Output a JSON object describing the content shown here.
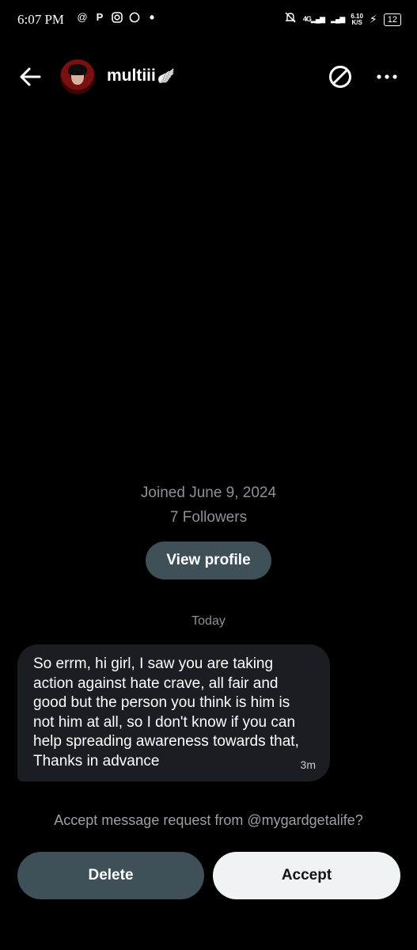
{
  "status_bar": {
    "time": "6:07 PM",
    "network": "4G",
    "speed_value": "6.10",
    "speed_unit": "K/S",
    "battery": "12"
  },
  "header": {
    "name": "multiii",
    "name_emoji": "🪽"
  },
  "profile": {
    "joined": "Joined June 9, 2024",
    "followers": "7 Followers",
    "view_profile_label": "View profile"
  },
  "chat": {
    "day_label": "Today",
    "message": "So errm, hi girl, I saw you are taking action against hate crave, all fair and good but the person you think is him is not him at all, so I don't know if you can help spreading awareness towards that, Thanks in advance",
    "time": "3m"
  },
  "request": {
    "text": "Accept message request from @mygardgetalife?",
    "delete_label": "Delete",
    "accept_label": "Accept"
  },
  "colors": {
    "background": "#000000",
    "secondary_button": "#3f5059",
    "bubble": "#1a1d21",
    "accept_button": "#eff3f4"
  }
}
